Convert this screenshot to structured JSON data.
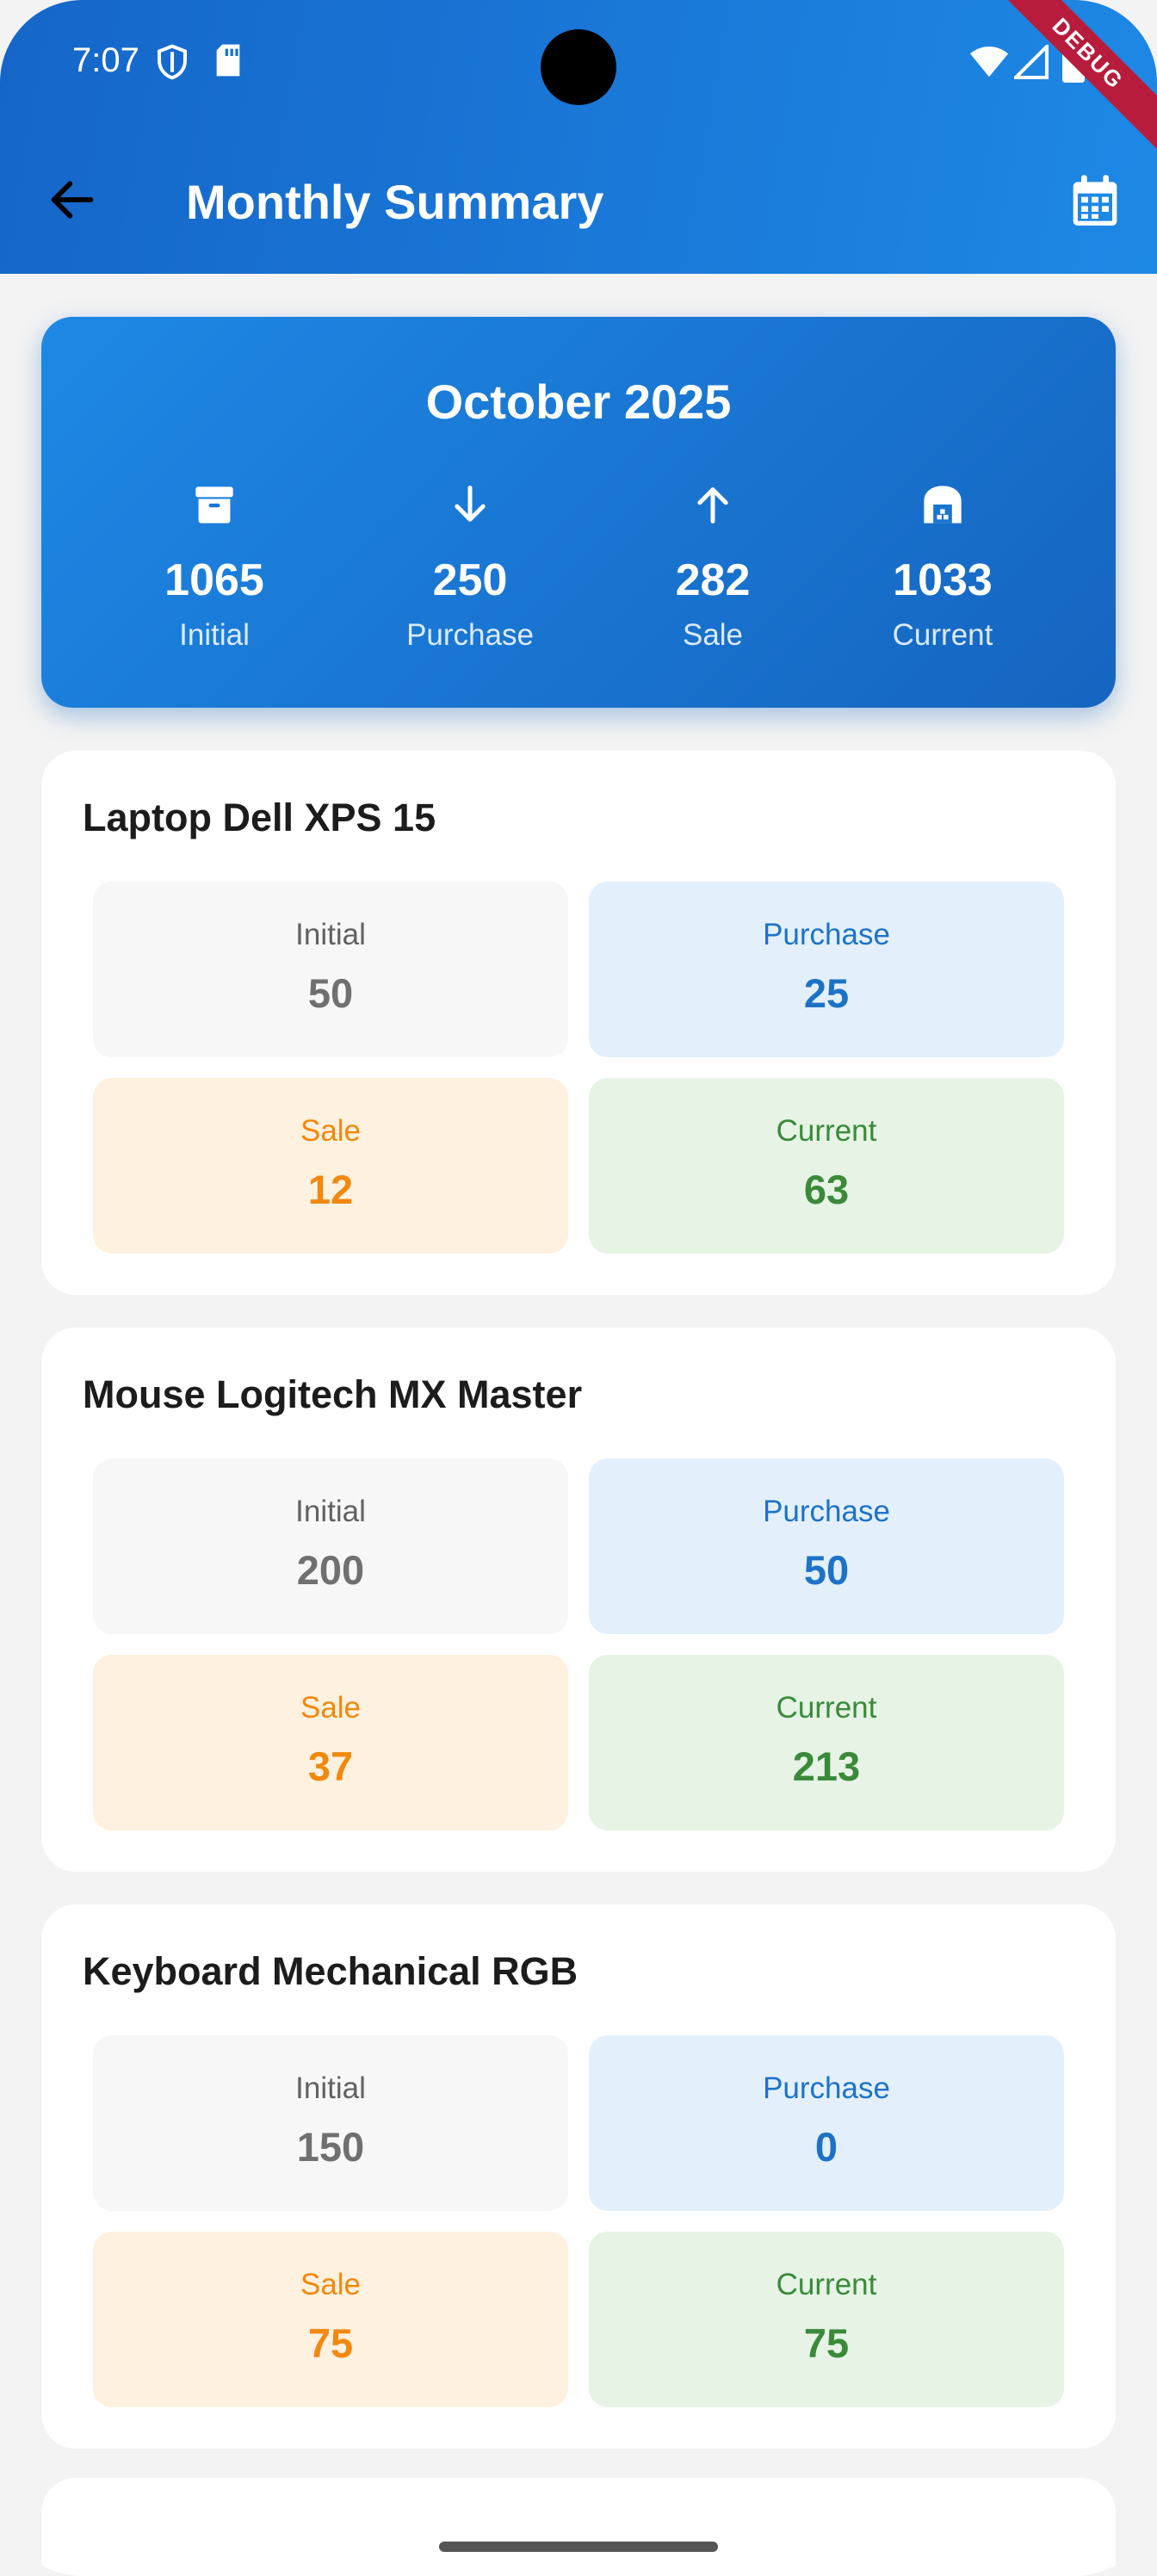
{
  "status": {
    "time": "7:07"
  },
  "debug_label": "DEBUG",
  "appbar": {
    "title": "Monthly Summary"
  },
  "summary": {
    "month": "October 2025",
    "stats": [
      {
        "icon": "archive-icon",
        "value": "1065",
        "label": "Initial"
      },
      {
        "icon": "arrow-down-icon",
        "value": "250",
        "label": "Purchase"
      },
      {
        "icon": "arrow-up-icon",
        "value": "282",
        "label": "Sale"
      },
      {
        "icon": "warehouse-icon",
        "value": "1033",
        "label": "Current"
      }
    ]
  },
  "products": [
    {
      "name": "Laptop Dell XPS 15",
      "initial": {
        "label": "Initial",
        "value": "50"
      },
      "purchase": {
        "label": "Purchase",
        "value": "25"
      },
      "sale": {
        "label": "Sale",
        "value": "12"
      },
      "current": {
        "label": "Current",
        "value": "63"
      }
    },
    {
      "name": "Mouse Logitech MX Master",
      "initial": {
        "label": "Initial",
        "value": "200"
      },
      "purchase": {
        "label": "Purchase",
        "value": "50"
      },
      "sale": {
        "label": "Sale",
        "value": "37"
      },
      "current": {
        "label": "Current",
        "value": "213"
      }
    },
    {
      "name": "Keyboard Mechanical RGB",
      "initial": {
        "label": "Initial",
        "value": "150"
      },
      "purchase": {
        "label": "Purchase",
        "value": "0"
      },
      "sale": {
        "label": "Sale",
        "value": "75"
      },
      "current": {
        "label": "Current",
        "value": "75"
      }
    }
  ],
  "colors": {
    "appbar": "#1e88e5",
    "hero_start": "#1e88e5",
    "hero_end": "#1565c0",
    "purchase": "#1e72c6",
    "sale": "#f0890e",
    "current": "#3a8a3a",
    "initial": "#707070"
  }
}
